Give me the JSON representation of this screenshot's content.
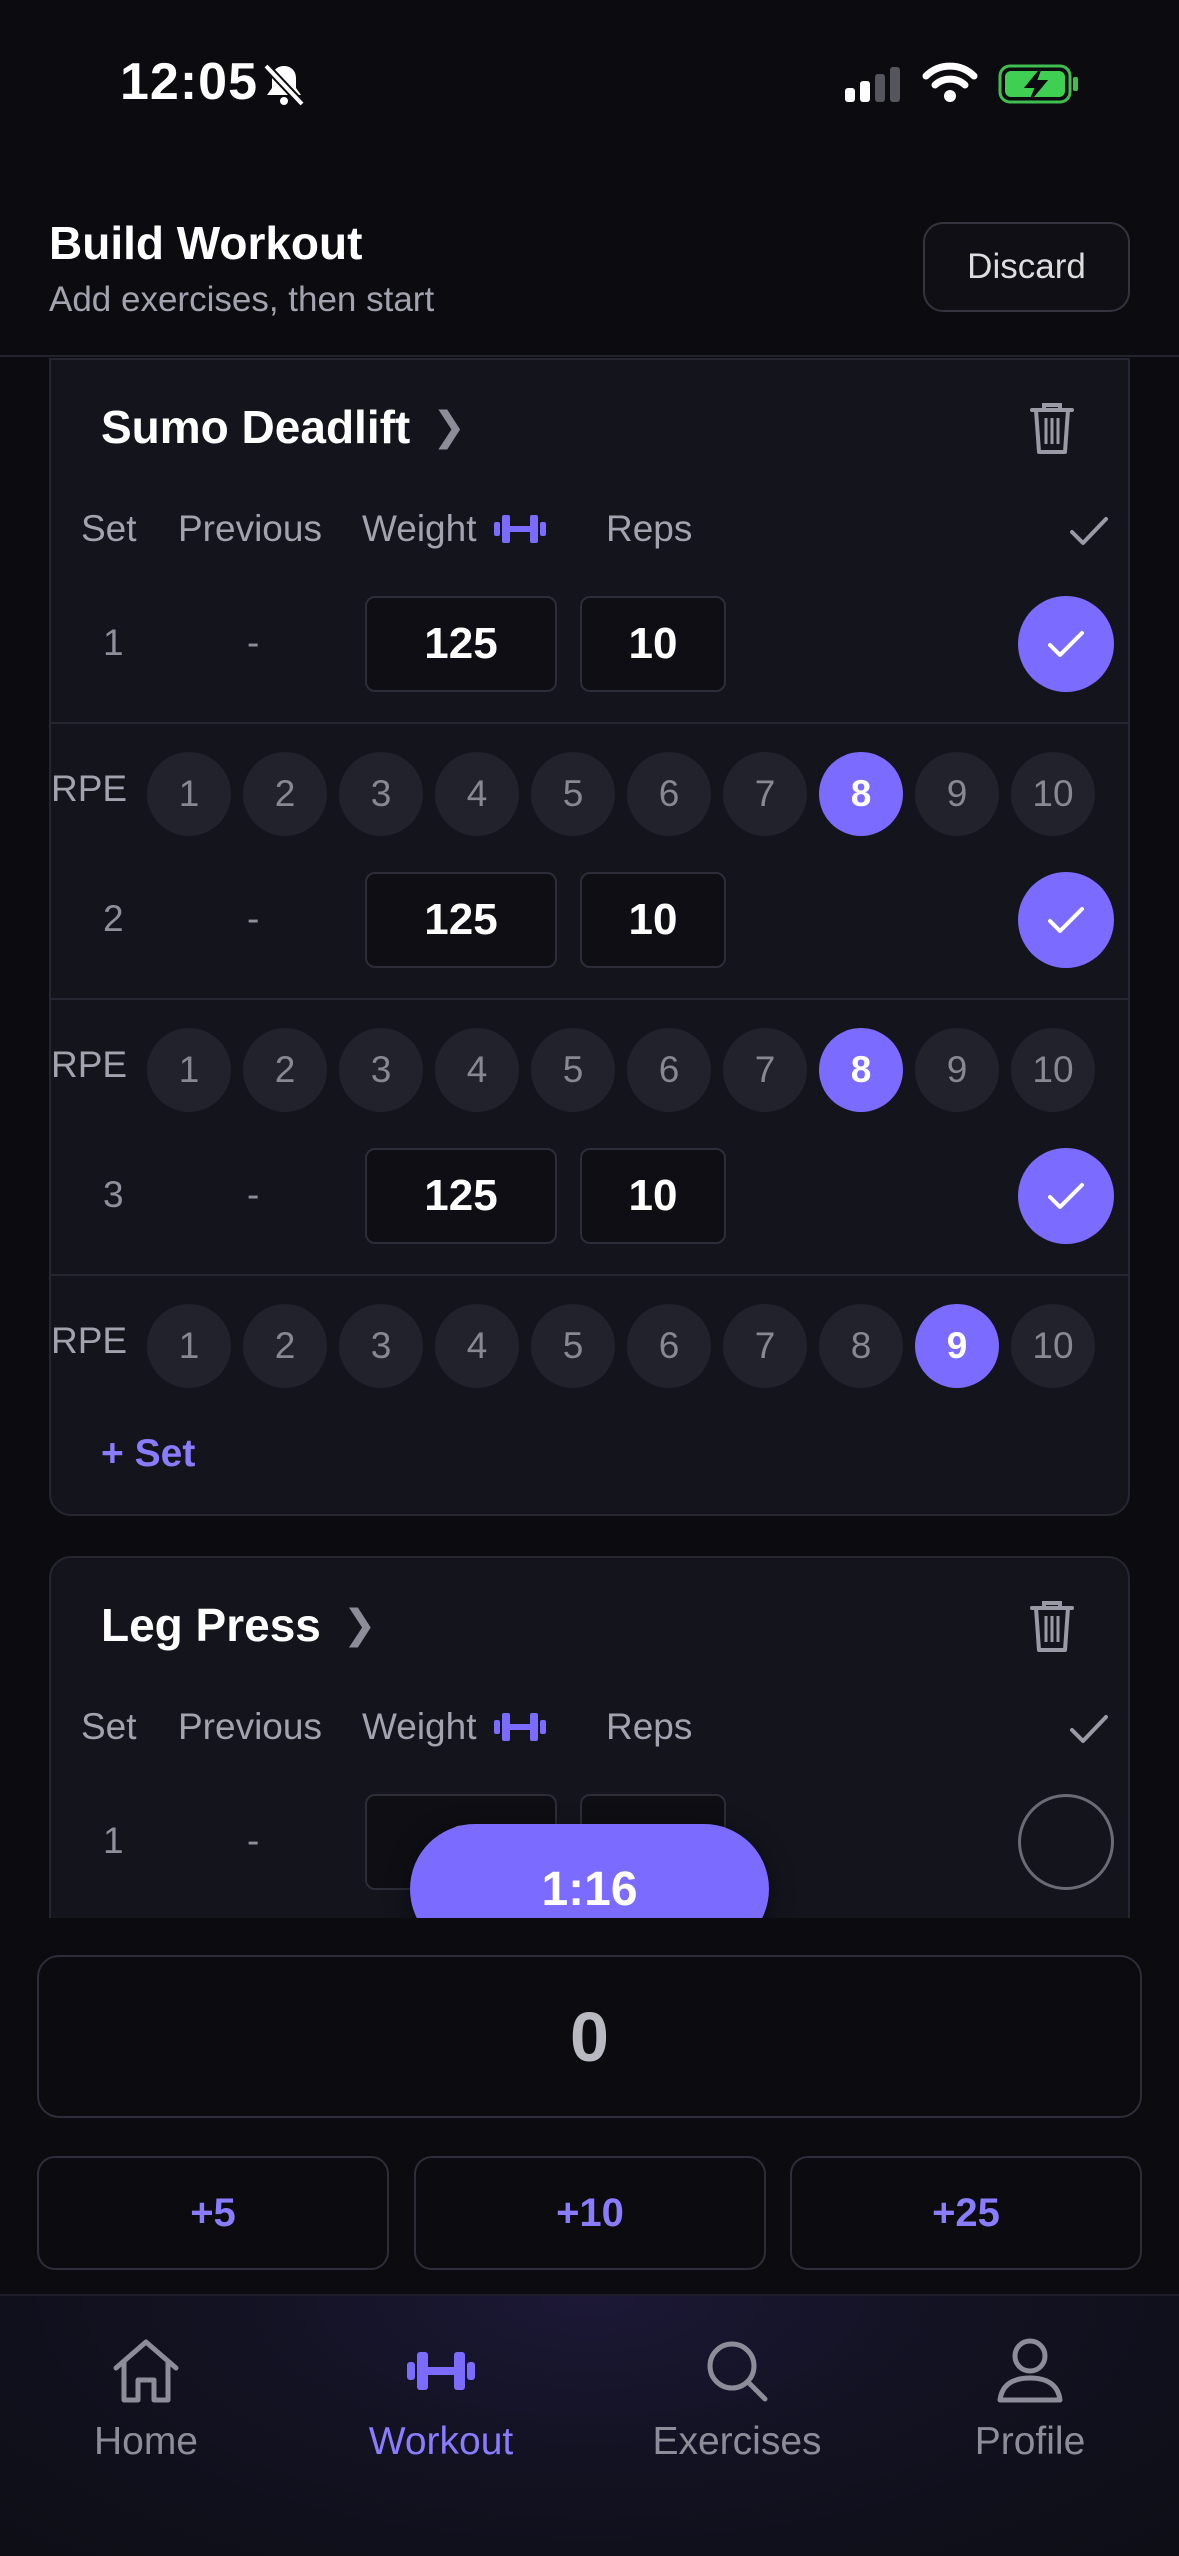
{
  "status": {
    "time": "12:05"
  },
  "header": {
    "title": "Build Workout",
    "subtitle": "Add exercises, then start",
    "discard": "Discard"
  },
  "columns": {
    "set": "Set",
    "previous": "Previous",
    "weight": "Weight",
    "reps": "Reps"
  },
  "exercises": [
    {
      "name": "Sumo Deadlift",
      "sets": [
        {
          "num": "1",
          "prev": "-",
          "weight": "125",
          "reps": "10",
          "done": true,
          "rpe_selected": 8
        },
        {
          "num": "2",
          "prev": "-",
          "weight": "125",
          "reps": "10",
          "done": true,
          "rpe_selected": 8
        },
        {
          "num": "3",
          "prev": "-",
          "weight": "125",
          "reps": "10",
          "done": true,
          "rpe_selected": 9
        }
      ],
      "add_set": "+ Set"
    },
    {
      "name": "Leg Press",
      "sets": [
        {
          "num": "1",
          "prev": "-",
          "weight": "0",
          "reps": "0",
          "done": false
        }
      ]
    }
  ],
  "rpe": {
    "label": "RPE",
    "options": [
      "1",
      "2",
      "3",
      "4",
      "5",
      "6",
      "7",
      "8",
      "9",
      "10"
    ]
  },
  "timer": "1:16",
  "keypad": {
    "value": "0",
    "increments": [
      "+5",
      "+10",
      "+25"
    ]
  },
  "tabs": [
    {
      "label": "Home",
      "icon": "home-icon",
      "active": false
    },
    {
      "label": "Workout",
      "icon": "dumbbell-icon",
      "active": true
    },
    {
      "label": "Exercises",
      "icon": "search-icon",
      "active": false
    },
    {
      "label": "Profile",
      "icon": "person-icon",
      "active": false
    }
  ],
  "colors": {
    "accent": "#7b6bff",
    "background": "#0b0b10",
    "card": "#14141d"
  }
}
